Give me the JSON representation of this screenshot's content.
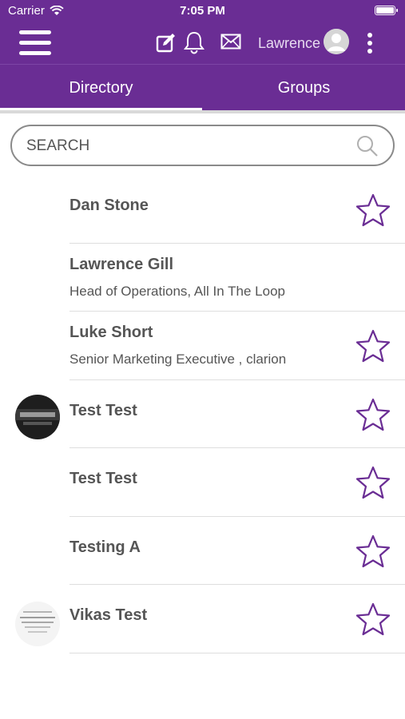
{
  "status_bar": {
    "carrier": "Carrier",
    "time": "7:05 PM"
  },
  "header": {
    "username": "Lawrence",
    "icons": [
      "menu-icon",
      "compose-icon",
      "bell-icon",
      "mail-icon",
      "avatar",
      "more-vertical-icon"
    ]
  },
  "tabs": [
    {
      "label": "Directory",
      "active": true
    },
    {
      "label": "Groups",
      "active": false
    }
  ],
  "search": {
    "placeholder": "SEARCH"
  },
  "colors": {
    "brand": "#6a2d94",
    "star": "#6a2d94",
    "text": "#555555"
  },
  "directory": [
    {
      "name": "Dan Stone",
      "subtitle": "",
      "starred": false,
      "has_avatar": false
    },
    {
      "name": "Lawrence Gill",
      "subtitle": "Head of Operations, All In The Loop",
      "starred": false,
      "has_avatar": false,
      "show_star": false
    },
    {
      "name": "Luke Short",
      "subtitle": "Senior Marketing Executive , clarion",
      "starred": false,
      "has_avatar": false
    },
    {
      "name": "Test Test",
      "subtitle": "",
      "starred": false,
      "has_avatar": true,
      "avatar_style": "dark-photo"
    },
    {
      "name": "Test Test",
      "subtitle": "",
      "starred": false,
      "has_avatar": false
    },
    {
      "name": "Testing A",
      "subtitle": "",
      "starred": false,
      "has_avatar": false
    },
    {
      "name": "Vikas Test",
      "subtitle": "",
      "starred": false,
      "has_avatar": true,
      "avatar_style": "document-photo"
    }
  ]
}
